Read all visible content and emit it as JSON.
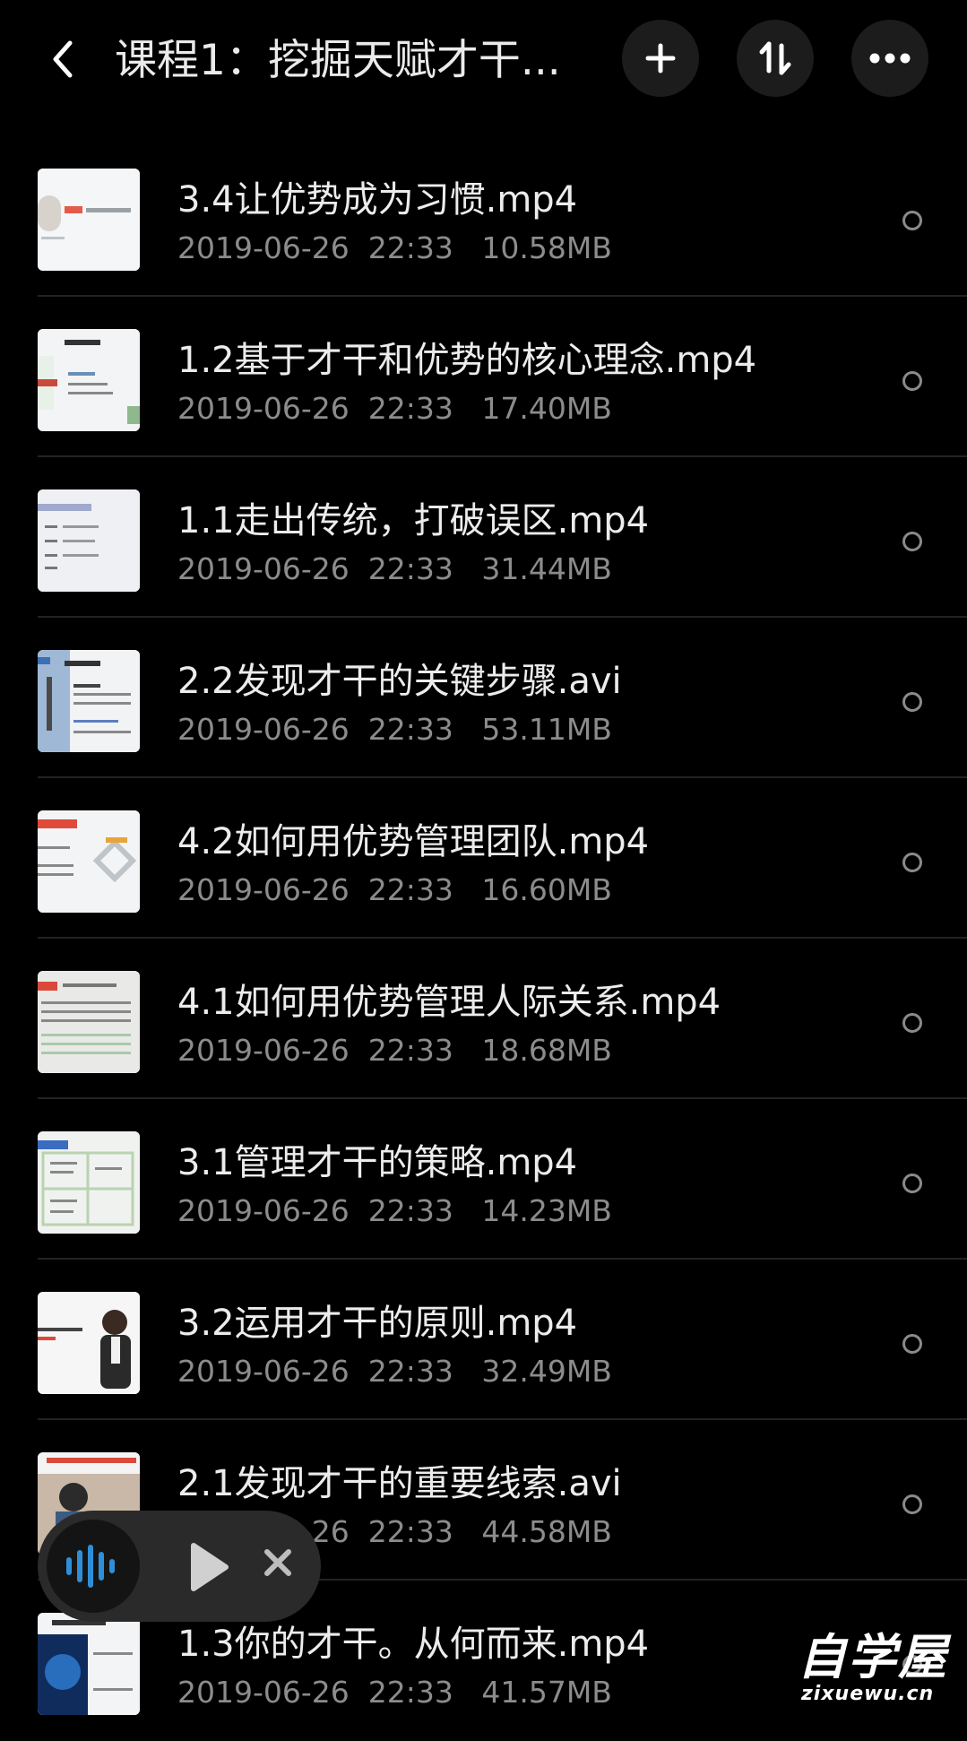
{
  "header": {
    "title": "课程1：挖掘天赋才干...",
    "back_icon": "back-arrow-icon",
    "add_icon": "plus-icon",
    "sort_icon": "sort-icon",
    "more_icon": "more-dots-icon"
  },
  "files": [
    {
      "name": "3.4让优势成为习惯.mp4",
      "date": "2019-06-26",
      "time": "22:33",
      "size": "10.58MB"
    },
    {
      "name": "1.2基于才干和优势的核心理念.mp4",
      "date": "2019-06-26",
      "time": "22:33",
      "size": "17.40MB"
    },
    {
      "name": "1.1走出传统，打破误区.mp4",
      "date": "2019-06-26",
      "time": "22:33",
      "size": "31.44MB"
    },
    {
      "name": "2.2发现才干的关键步骤.avi",
      "date": "2019-06-26",
      "time": "22:33",
      "size": "53.11MB"
    },
    {
      "name": "4.2如何用优势管理团队.mp4",
      "date": "2019-06-26",
      "time": "22:33",
      "size": "16.60MB"
    },
    {
      "name": "4.1如何用优势管理人际关系.mp4",
      "date": "2019-06-26",
      "time": "22:33",
      "size": "18.68MB"
    },
    {
      "name": "3.1管理才干的策略.mp4",
      "date": "2019-06-26",
      "time": "22:33",
      "size": "14.23MB"
    },
    {
      "name": "3.2运用才干的原则.mp4",
      "date": "2019-06-26",
      "time": "22:33",
      "size": "32.49MB"
    },
    {
      "name": "2.1发现才干的重要线索.avi",
      "date": "2019-06-26",
      "time": "22:33",
      "size": "44.58MB"
    },
    {
      "name": "1.3你的才干。从何而来.mp4",
      "date": "2019-06-26",
      "time": "22:33",
      "size": "41.57MB"
    }
  ],
  "player": {
    "wave_icon": "audio-wave-icon",
    "play_icon": "play-icon",
    "close_icon": "close-icon"
  },
  "watermark": {
    "cn": "自学屋",
    "en": "zixuewu.cn"
  },
  "colors": {
    "background": "#000000",
    "accent_blue": "#2e8fd8",
    "secondary_text": "#8c8c8c"
  }
}
